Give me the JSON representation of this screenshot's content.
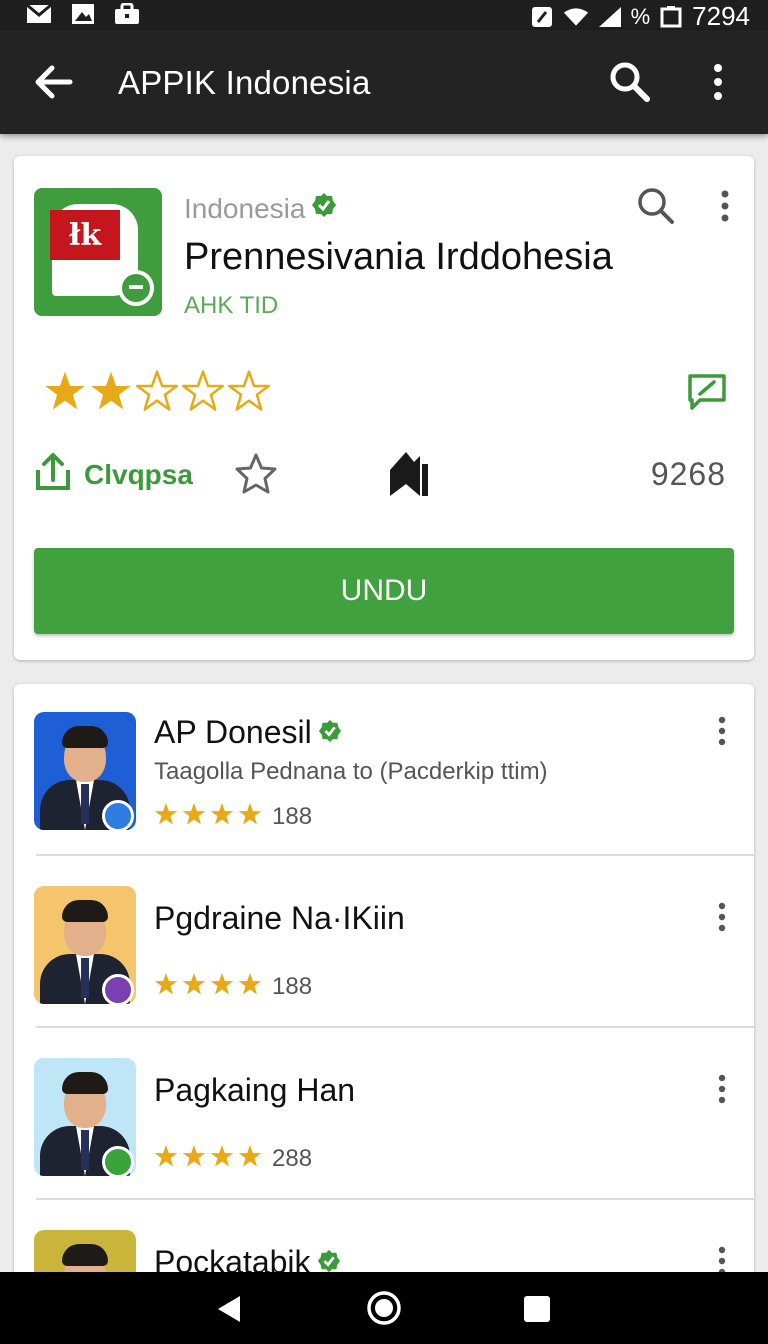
{
  "status_bar": {
    "left_icons": [
      "mail-icon",
      "image-icon",
      "briefcase-icon"
    ],
    "right_icons": [
      "nfc-icon",
      "wifi-icon",
      "signal-icon"
    ],
    "percent": "%",
    "time": "7294"
  },
  "app_bar": {
    "title": "APPIK Indonesia",
    "icons": [
      "back-arrow-icon",
      "search-icon",
      "more-vert-icon"
    ]
  },
  "app_card": {
    "icon_text": "łk",
    "developer": "Indonesia",
    "title": "Prennesivania Irddohesia",
    "subtitle": "AHK TID",
    "rating_filled": 2,
    "rating_max": 5,
    "share_label": "Clvqpsa",
    "count": "9268",
    "install_label": "UNDU"
  },
  "list": [
    {
      "title": "AP Donesil",
      "verified": true,
      "description": "Taagolla Pednana to (Pacderkip ttim)",
      "stars": 4,
      "count": "188",
      "thumb_bg": "#1e5fd6",
      "badge_color": "#2f7de1"
    },
    {
      "title": "Pgdraine Na·IKiin",
      "verified": false,
      "description": "",
      "stars": 4,
      "count": "188",
      "thumb_bg": "#f4c56a",
      "badge_color": "#7a3fb0"
    },
    {
      "title": "Pagkaing Han",
      "verified": false,
      "description": "",
      "stars": 4,
      "count": "288",
      "thumb_bg": "#bfe6f7",
      "badge_color": "#3aa33a"
    },
    {
      "title": "Pockatabik",
      "verified": true,
      "description": "",
      "stars": 0,
      "count": "",
      "thumb_bg": "#c9b53a",
      "badge_color": "#3aa33a"
    }
  ],
  "colors": {
    "accent_green": "#41a13f",
    "star_gold": "#e8a917",
    "appbar_bg": "#232323"
  }
}
